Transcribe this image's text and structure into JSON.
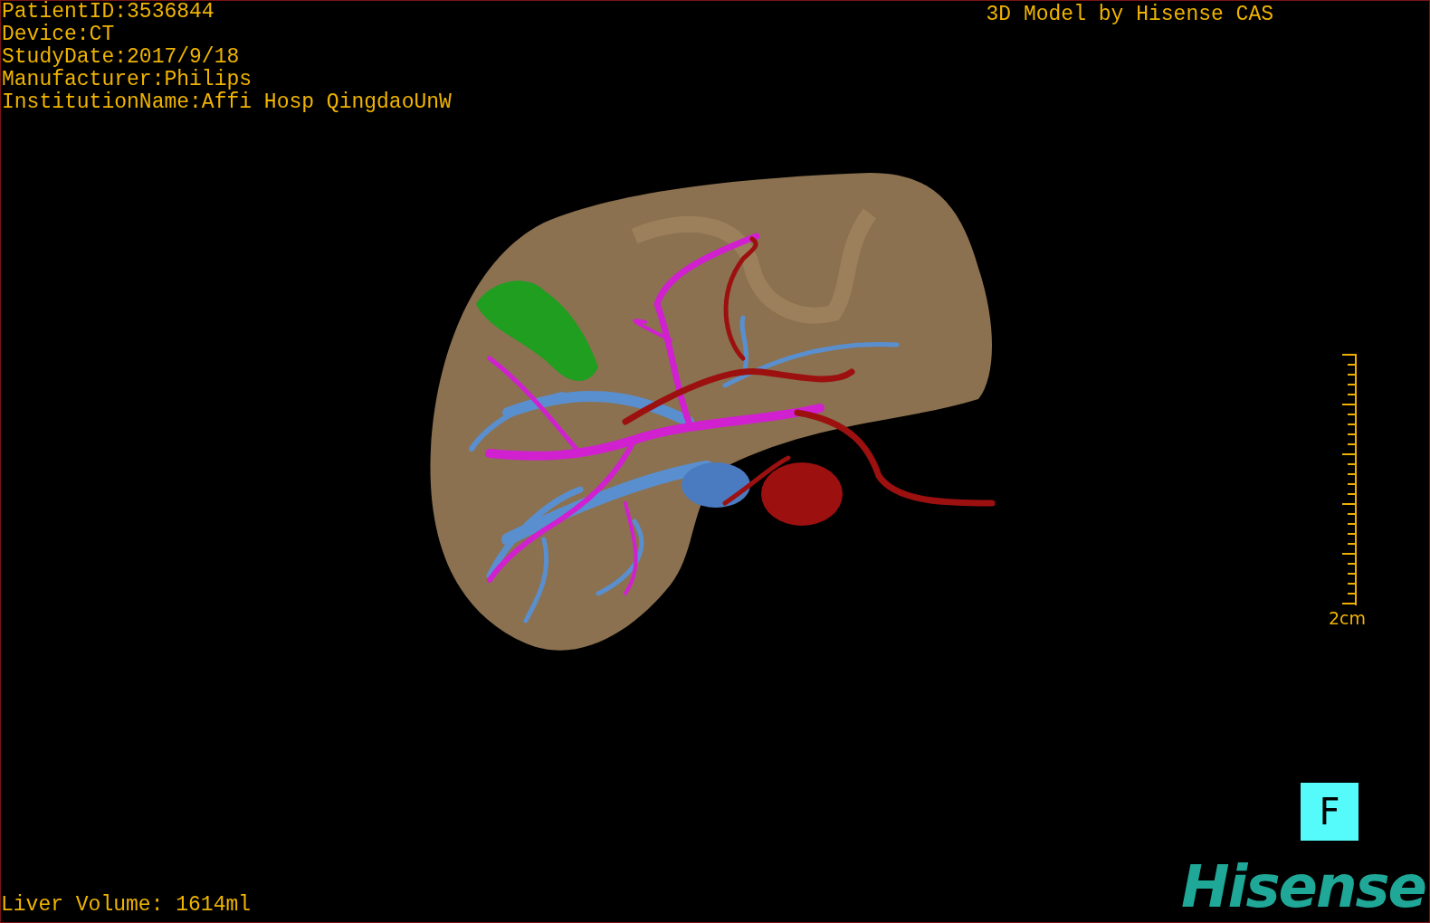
{
  "info": [
    "PatientID:3536844",
    "Device:CT",
    "StudyDate:2017/9/18",
    "Manufacturer:Philips",
    "InstitutionName:Affi Hosp QingdaoUnW"
  ],
  "title": "3D Model by Hisense CAS",
  "scale": {
    "label": "2cm"
  },
  "orientation_button": "F",
  "volume": "Liver Volume: 1614ml",
  "logo": "Hisense"
}
